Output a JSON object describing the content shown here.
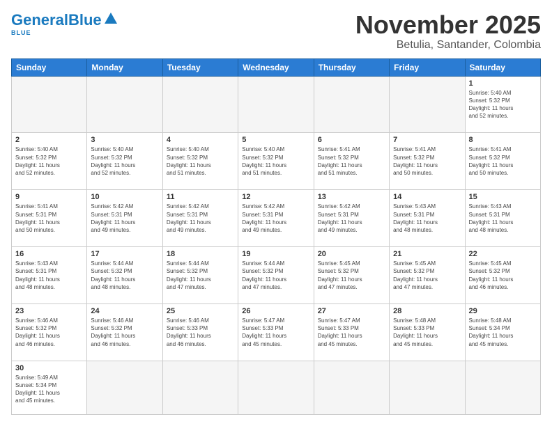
{
  "header": {
    "logo_general": "General",
    "logo_blue": "Blue",
    "logo_sub": "BLUE",
    "month": "November 2025",
    "location": "Betulia, Santander, Colombia"
  },
  "weekdays": [
    "Sunday",
    "Monday",
    "Tuesday",
    "Wednesday",
    "Thursday",
    "Friday",
    "Saturday"
  ],
  "weeks": [
    [
      {
        "day": "",
        "info": ""
      },
      {
        "day": "",
        "info": ""
      },
      {
        "day": "",
        "info": ""
      },
      {
        "day": "",
        "info": ""
      },
      {
        "day": "",
        "info": ""
      },
      {
        "day": "",
        "info": ""
      },
      {
        "day": "1",
        "info": "Sunrise: 5:40 AM\nSunset: 5:32 PM\nDaylight: 11 hours\nand 52 minutes."
      }
    ],
    [
      {
        "day": "2",
        "info": "Sunrise: 5:40 AM\nSunset: 5:32 PM\nDaylight: 11 hours\nand 52 minutes."
      },
      {
        "day": "3",
        "info": "Sunrise: 5:40 AM\nSunset: 5:32 PM\nDaylight: 11 hours\nand 52 minutes."
      },
      {
        "day": "4",
        "info": "Sunrise: 5:40 AM\nSunset: 5:32 PM\nDaylight: 11 hours\nand 51 minutes."
      },
      {
        "day": "5",
        "info": "Sunrise: 5:40 AM\nSunset: 5:32 PM\nDaylight: 11 hours\nand 51 minutes."
      },
      {
        "day": "6",
        "info": "Sunrise: 5:41 AM\nSunset: 5:32 PM\nDaylight: 11 hours\nand 51 minutes."
      },
      {
        "day": "7",
        "info": "Sunrise: 5:41 AM\nSunset: 5:32 PM\nDaylight: 11 hours\nand 50 minutes."
      },
      {
        "day": "8",
        "info": "Sunrise: 5:41 AM\nSunset: 5:32 PM\nDaylight: 11 hours\nand 50 minutes."
      }
    ],
    [
      {
        "day": "9",
        "info": "Sunrise: 5:41 AM\nSunset: 5:31 PM\nDaylight: 11 hours\nand 50 minutes."
      },
      {
        "day": "10",
        "info": "Sunrise: 5:42 AM\nSunset: 5:31 PM\nDaylight: 11 hours\nand 49 minutes."
      },
      {
        "day": "11",
        "info": "Sunrise: 5:42 AM\nSunset: 5:31 PM\nDaylight: 11 hours\nand 49 minutes."
      },
      {
        "day": "12",
        "info": "Sunrise: 5:42 AM\nSunset: 5:31 PM\nDaylight: 11 hours\nand 49 minutes."
      },
      {
        "day": "13",
        "info": "Sunrise: 5:42 AM\nSunset: 5:31 PM\nDaylight: 11 hours\nand 49 minutes."
      },
      {
        "day": "14",
        "info": "Sunrise: 5:43 AM\nSunset: 5:31 PM\nDaylight: 11 hours\nand 48 minutes."
      },
      {
        "day": "15",
        "info": "Sunrise: 5:43 AM\nSunset: 5:31 PM\nDaylight: 11 hours\nand 48 minutes."
      }
    ],
    [
      {
        "day": "16",
        "info": "Sunrise: 5:43 AM\nSunset: 5:31 PM\nDaylight: 11 hours\nand 48 minutes."
      },
      {
        "day": "17",
        "info": "Sunrise: 5:44 AM\nSunset: 5:32 PM\nDaylight: 11 hours\nand 48 minutes."
      },
      {
        "day": "18",
        "info": "Sunrise: 5:44 AM\nSunset: 5:32 PM\nDaylight: 11 hours\nand 47 minutes."
      },
      {
        "day": "19",
        "info": "Sunrise: 5:44 AM\nSunset: 5:32 PM\nDaylight: 11 hours\nand 47 minutes."
      },
      {
        "day": "20",
        "info": "Sunrise: 5:45 AM\nSunset: 5:32 PM\nDaylight: 11 hours\nand 47 minutes."
      },
      {
        "day": "21",
        "info": "Sunrise: 5:45 AM\nSunset: 5:32 PM\nDaylight: 11 hours\nand 47 minutes."
      },
      {
        "day": "22",
        "info": "Sunrise: 5:45 AM\nSunset: 5:32 PM\nDaylight: 11 hours\nand 46 minutes."
      }
    ],
    [
      {
        "day": "23",
        "info": "Sunrise: 5:46 AM\nSunset: 5:32 PM\nDaylight: 11 hours\nand 46 minutes."
      },
      {
        "day": "24",
        "info": "Sunrise: 5:46 AM\nSunset: 5:32 PM\nDaylight: 11 hours\nand 46 minutes."
      },
      {
        "day": "25",
        "info": "Sunrise: 5:46 AM\nSunset: 5:33 PM\nDaylight: 11 hours\nand 46 minutes."
      },
      {
        "day": "26",
        "info": "Sunrise: 5:47 AM\nSunset: 5:33 PM\nDaylight: 11 hours\nand 45 minutes."
      },
      {
        "day": "27",
        "info": "Sunrise: 5:47 AM\nSunset: 5:33 PM\nDaylight: 11 hours\nand 45 minutes."
      },
      {
        "day": "28",
        "info": "Sunrise: 5:48 AM\nSunset: 5:33 PM\nDaylight: 11 hours\nand 45 minutes."
      },
      {
        "day": "29",
        "info": "Sunrise: 5:48 AM\nSunset: 5:34 PM\nDaylight: 11 hours\nand 45 minutes."
      }
    ],
    [
      {
        "day": "30",
        "info": "Sunrise: 5:49 AM\nSunset: 5:34 PM\nDaylight: 11 hours\nand 45 minutes."
      },
      {
        "day": "",
        "info": ""
      },
      {
        "day": "",
        "info": ""
      },
      {
        "day": "",
        "info": ""
      },
      {
        "day": "",
        "info": ""
      },
      {
        "day": "",
        "info": ""
      },
      {
        "day": "",
        "info": ""
      }
    ]
  ]
}
